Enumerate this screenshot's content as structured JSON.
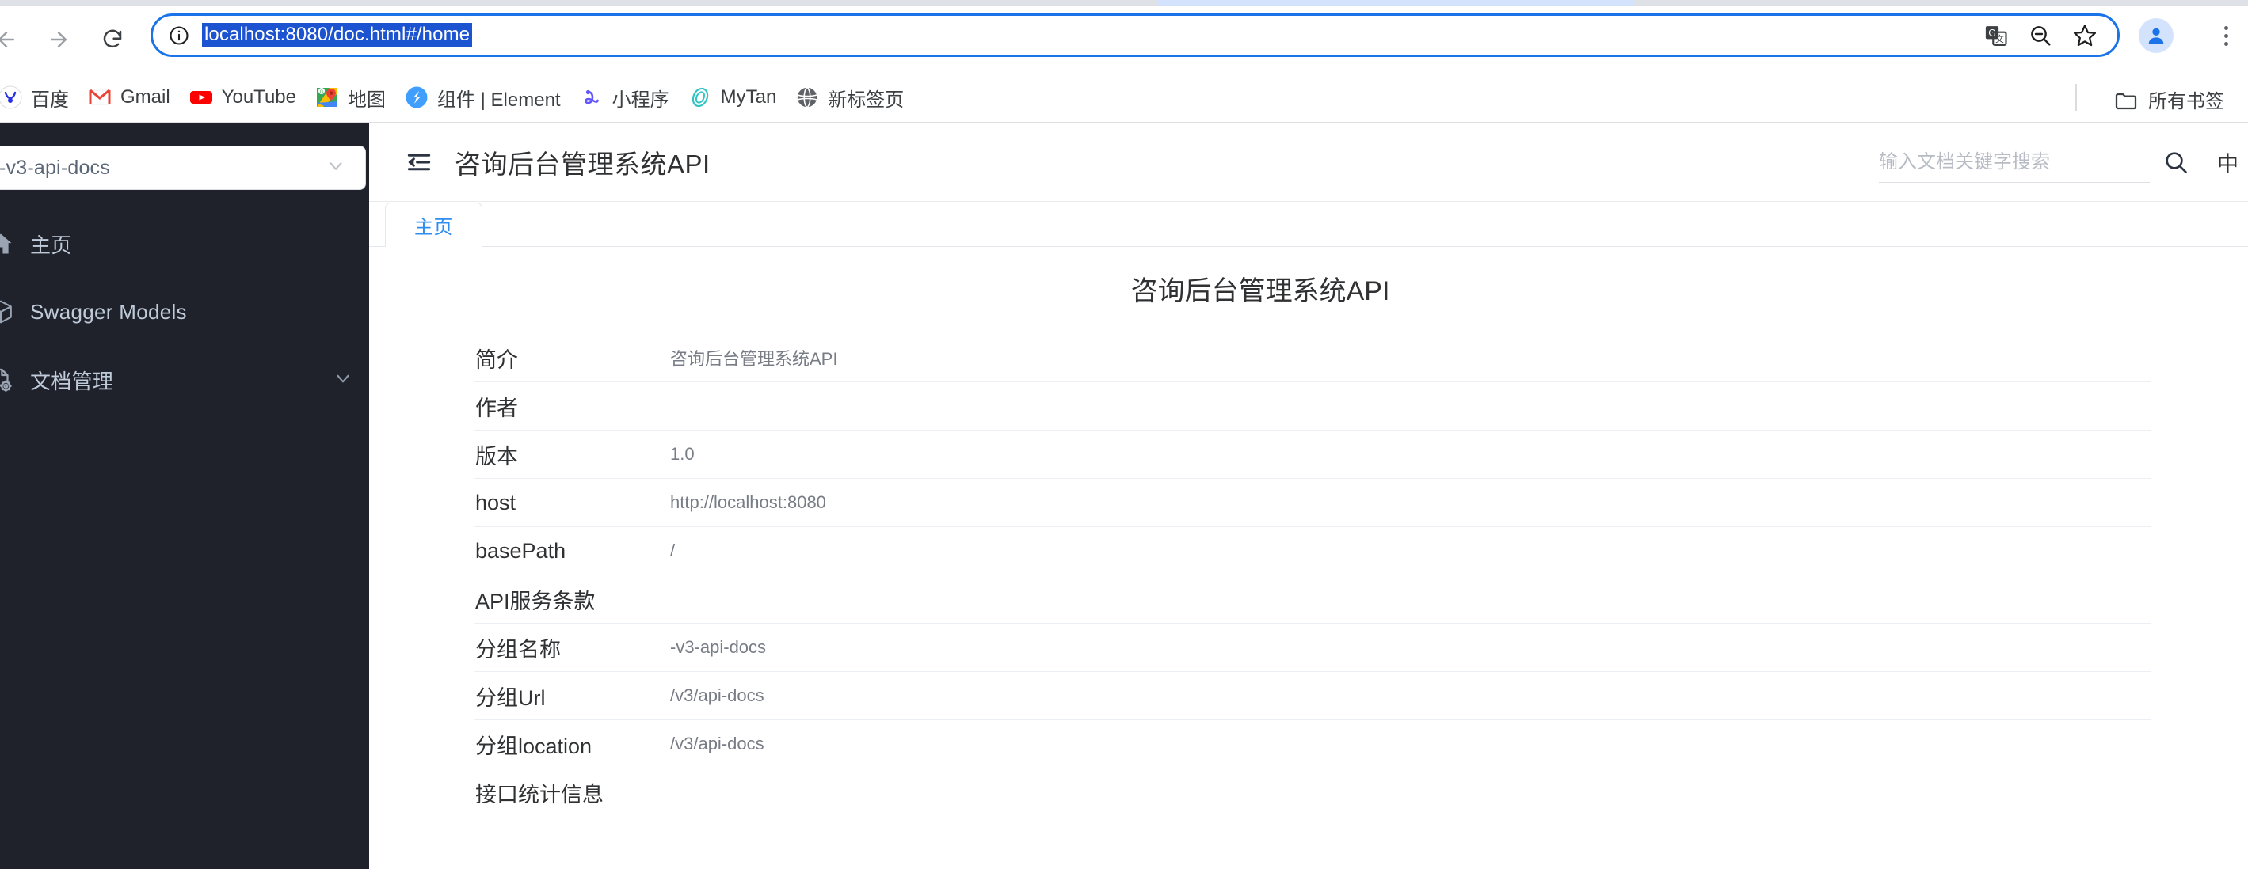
{
  "browser": {
    "back_label": "Back",
    "forward_label": "Forward",
    "reload_label": "Reload",
    "site_info_label": "View site information",
    "url": "localhost:8080/doc.html#/home",
    "translate_label": "Translate this page",
    "zoom_label": "Zoom out",
    "bookmark_label": "Bookmark this tab",
    "profile_label": "Profile",
    "menu_label": "Customize and control Google Chrome",
    "url_selection_color": "#1b53d0",
    "omnibox_focus_color": "#1a73e8"
  },
  "bookmarks": {
    "items": [
      {
        "label": "百度",
        "icon": "baidu-icon"
      },
      {
        "label": "Gmail",
        "icon": "gmail-icon"
      },
      {
        "label": "YouTube",
        "icon": "youtube-icon"
      },
      {
        "label": "地图",
        "icon": "google-maps-icon"
      },
      {
        "label": "组件 | Element",
        "icon": "element-ui-icon"
      },
      {
        "label": "小程序",
        "icon": "mini-program-icon"
      },
      {
        "label": "MyTan",
        "icon": "mytan-icon"
      },
      {
        "label": "新标签页",
        "icon": "globe-icon"
      }
    ],
    "all_bookmarks_label": "所有书签"
  },
  "sidebar": {
    "background_color": "#20222b",
    "group_select": {
      "value": "-v3-api-docs",
      "caret_icon": "chevron-down-icon"
    },
    "items": [
      {
        "label": "主页",
        "icon": "home-icon",
        "expandable": false
      },
      {
        "label": "Swagger Models",
        "icon": "cube-icon",
        "expandable": false
      },
      {
        "label": "文档管理",
        "icon": "document-settings-icon",
        "expandable": true
      }
    ]
  },
  "header": {
    "collapse_icon": "collapse-menu-icon",
    "title": "咨询后台管理系统API",
    "search": {
      "placeholder": "输入文档关键字搜索",
      "value": "",
      "icon": "search-icon"
    },
    "language_toggle": "中"
  },
  "tabs": [
    {
      "label": "主页",
      "active": true
    }
  ],
  "content": {
    "title": "咨询后台管理系统API",
    "rows": [
      {
        "key": "简介",
        "value": "咨询后台管理系统API"
      },
      {
        "key": "作者",
        "value": ""
      },
      {
        "key": "版本",
        "value": "1.0"
      },
      {
        "key": "host",
        "value": "http://localhost:8080"
      },
      {
        "key": "basePath",
        "value": "/"
      },
      {
        "key": "API服务条款",
        "value": ""
      },
      {
        "key": "分组名称",
        "value": "-v3-api-docs"
      },
      {
        "key": "分组Url",
        "value": "/v3/api-docs"
      },
      {
        "key": "分组location",
        "value": "/v3/api-docs"
      },
      {
        "key": "接口统计信息",
        "value": ""
      }
    ]
  },
  "theme": {
    "accent_blue": "#2f8cf0",
    "sidebar_text": "#bfcbd9",
    "text_primary": "#303133",
    "text_secondary": "#777c85",
    "divider": "#ebeef5"
  }
}
